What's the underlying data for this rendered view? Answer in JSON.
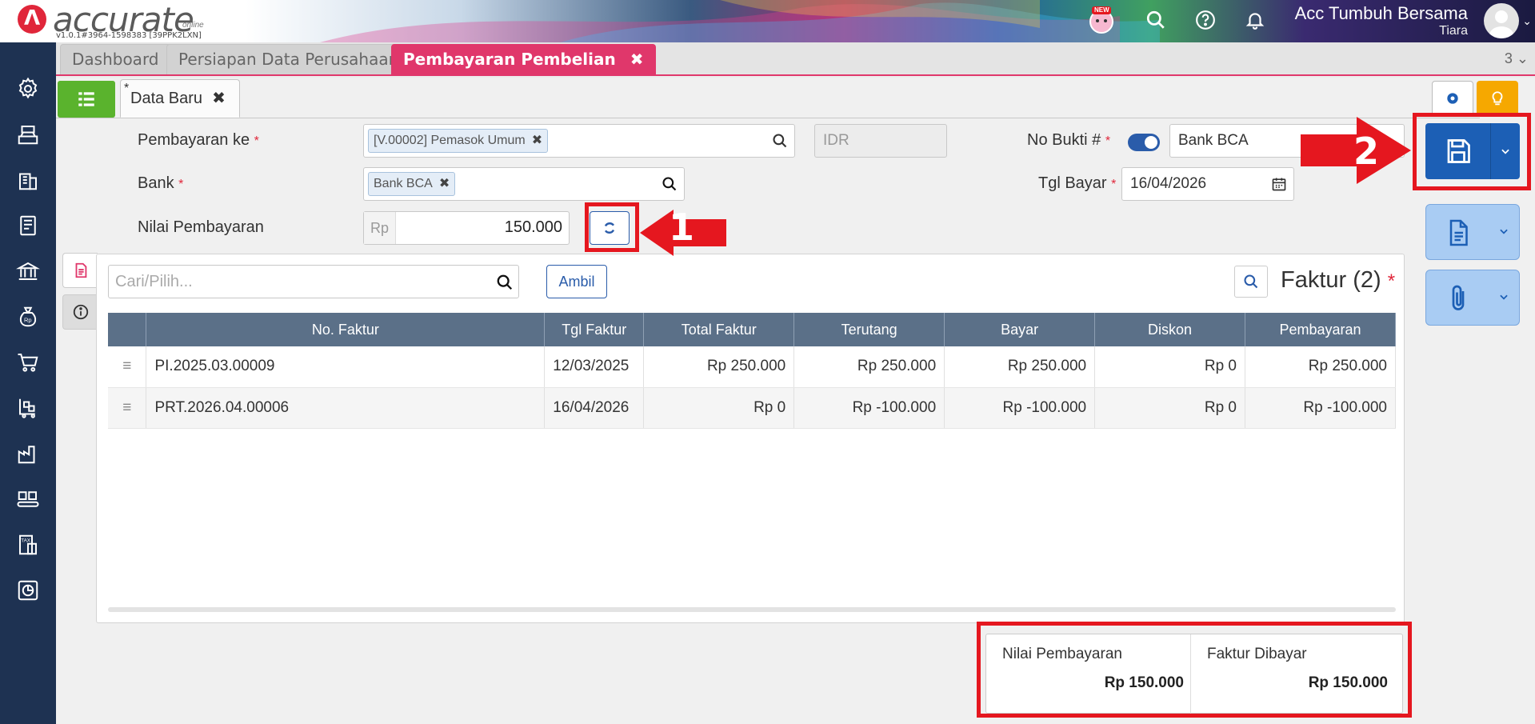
{
  "header": {
    "logo_text": "accurate",
    "logo_sub": "online",
    "version": "v1.0.1#3964-1598383 [39PPK2LXN]",
    "new_badge": "NEW",
    "company": "Acc Tumbuh Bersama",
    "user": "Tiara"
  },
  "tabs": {
    "items": [
      {
        "label": "Dashboard"
      },
      {
        "label": "Persiapan Data Perusahaan"
      },
      {
        "label": "Pembayaran Pembelian"
      }
    ],
    "count": "3"
  },
  "subtab": {
    "star": "*",
    "label": "Data Baru"
  },
  "form": {
    "pembayaran_ke_label": "Pembayaran ke",
    "pembayaran_ke_value": "[V.00002] Pemasok Umum",
    "currency": "IDR",
    "no_bukti_label": "No Bukti #",
    "no_bukti_value": "Bank BCA",
    "bank_label": "Bank",
    "bank_value": "Bank BCA",
    "tgl_bayar_label": "Tgl Bayar",
    "tgl_bayar_value": "16/04/2026",
    "nilai_label": "Nilai Pembayaran",
    "nilai_prefix": "Rp",
    "nilai_value": "150.000",
    "required_mark": "*"
  },
  "panel": {
    "search_placeholder": "Cari/Pilih...",
    "ambil_label": "Ambil",
    "faktur_title": "Faktur (2)",
    "columns": [
      "No. Faktur",
      "Tgl Faktur",
      "Total Faktur",
      "Terutang",
      "Bayar",
      "Diskon",
      "Pembayaran"
    ],
    "rows": [
      {
        "no": "PI.2025.03.00009",
        "tgl": "12/03/2025",
        "total": "Rp 250.000",
        "terutang": "Rp 250.000",
        "bayar": "Rp 250.000",
        "diskon": "Rp 0",
        "pembayaran": "Rp 250.000"
      },
      {
        "no": "PRT.2026.04.00006",
        "tgl": "16/04/2026",
        "total": "Rp 0",
        "terutang": "Rp -100.000",
        "bayar": "Rp -100.000",
        "diskon": "Rp 0",
        "pembayaran": "Rp -100.000"
      }
    ]
  },
  "summary": {
    "nilai_label": "Nilai Pembayaran",
    "nilai_value": "Rp 150.000",
    "faktur_label": "Faktur Dibayar",
    "faktur_value": "Rp 150.000"
  },
  "annotations": {
    "one": "1",
    "two": "2"
  },
  "colors": {
    "accent": "#e0376b",
    "sidebar": "#1e3252",
    "primary": "#1c5fb5",
    "annotation": "#e5171f",
    "list_button": "#5ab32d"
  }
}
